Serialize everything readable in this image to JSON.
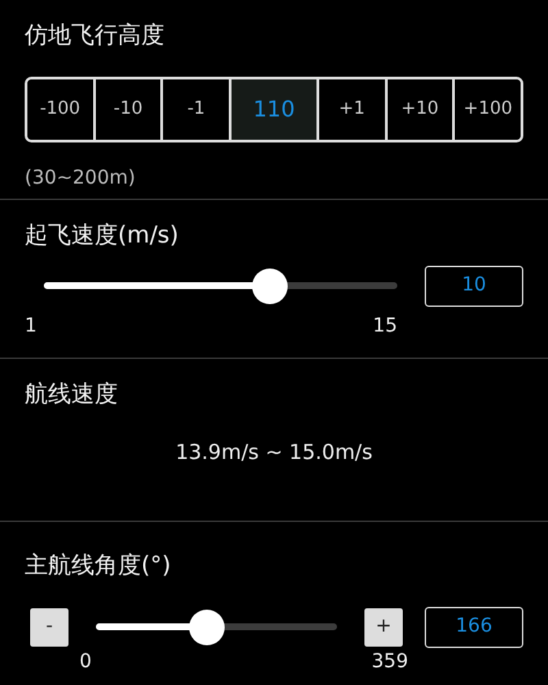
{
  "altitude": {
    "title": "仿地飞行高度",
    "steps": [
      {
        "label": "-100",
        "kind": "step",
        "selected": false
      },
      {
        "label": "-10",
        "kind": "step",
        "selected": false
      },
      {
        "label": "-1",
        "kind": "step",
        "selected": false
      },
      {
        "label": "110",
        "kind": "value",
        "selected": true
      },
      {
        "label": "+1",
        "kind": "step",
        "selected": false
      },
      {
        "label": "+10",
        "kind": "step",
        "selected": false
      },
      {
        "label": "+100",
        "kind": "step",
        "selected": false
      }
    ],
    "range": "(30~200m)"
  },
  "takeoff_speed": {
    "title": "起飞速度(m/s)",
    "level": 0.64,
    "min": "1",
    "max": "15",
    "value": "10"
  },
  "route_speed": {
    "title": "航线速度",
    "range": "13.9m/s ~ 15.0m/s"
  },
  "main_angle": {
    "title": "主航线角度(°)",
    "minus": "-",
    "plus": "+",
    "level": 0.46,
    "min": "0",
    "max": "359",
    "value": "166"
  }
}
